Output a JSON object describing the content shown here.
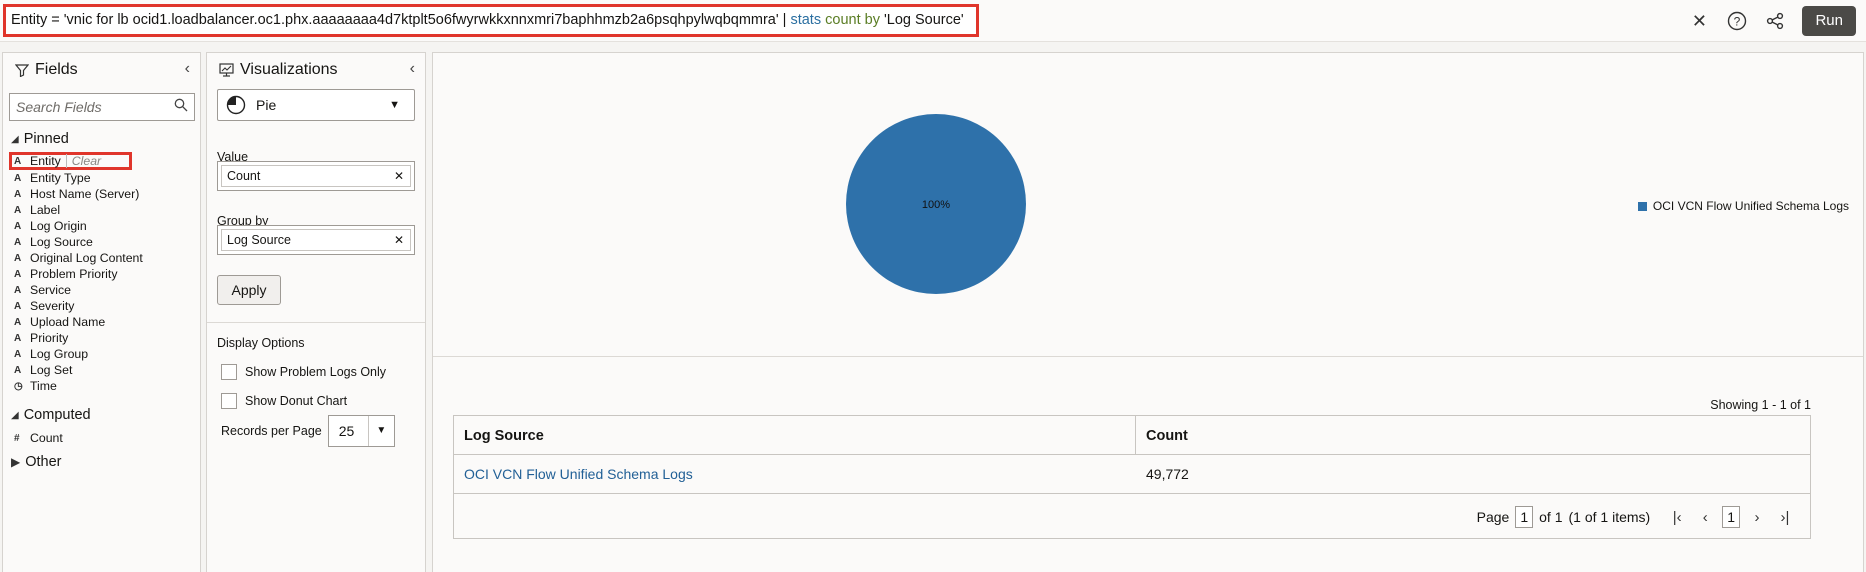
{
  "query": {
    "prefix": "Entity = 'vnic for lb ocid1.loadbalancer.oc1.phx.aaaaaaaa4d7ktplt5o6fwyrwkkxnnxmri7baphhmzb2a6psqhpylwqbqmmra' | ",
    "kw_stats": "stats",
    "kw_count": "count",
    "kw_by": "by",
    "suffix": "'Log Source'"
  },
  "toolbar": {
    "run_label": "Run"
  },
  "fields_panel": {
    "title": "Fields",
    "search_placeholder": "Search Fields",
    "pinned_label": "Pinned",
    "pinned": [
      {
        "type": "A",
        "label": "Entity",
        "clear": "Clear"
      },
      {
        "type": "A",
        "label": "Entity Type"
      },
      {
        "type": "A",
        "label": "Host Name (Server)"
      },
      {
        "type": "A",
        "label": "Label"
      },
      {
        "type": "A",
        "label": "Log Origin"
      },
      {
        "type": "A",
        "label": "Log Source"
      },
      {
        "type": "A",
        "label": "Original Log Content"
      },
      {
        "type": "A",
        "label": "Problem Priority"
      },
      {
        "type": "A",
        "label": "Service"
      },
      {
        "type": "A",
        "label": "Severity"
      },
      {
        "type": "A",
        "label": "Upload Name"
      },
      {
        "type": "A",
        "label": "Priority"
      },
      {
        "type": "A",
        "label": "Log Group"
      },
      {
        "type": "A",
        "label": "Log Set"
      },
      {
        "type": "◷",
        "label": "Time"
      }
    ],
    "computed_label": "Computed",
    "computed": [
      {
        "type": "#",
        "label": "Count"
      }
    ],
    "other_label": "Other"
  },
  "viz_panel": {
    "title": "Visualizations",
    "selected": "Pie",
    "value_label": "Value",
    "value_chip": "Count",
    "groupby_label": "Group by",
    "groupby_chip": "Log Source",
    "apply_label": "Apply",
    "display_options_label": "Display Options",
    "opt_problem": "Show Problem Logs Only",
    "opt_donut": "Show Donut Chart",
    "rpp_label": "Records per Page",
    "rpp_value": "25"
  },
  "chart_data": {
    "type": "pie",
    "slices": [
      {
        "label": "OCI VCN Flow Unified Schema Logs",
        "value": 100,
        "color": "#2e71aa"
      }
    ],
    "data_label": "100%",
    "legend": [
      "OCI VCN Flow Unified Schema Logs"
    ],
    "legend_position": "right"
  },
  "table": {
    "showing": "Showing 1 - 1 of 1",
    "columns": [
      "Log Source",
      "Count"
    ],
    "rows": [
      [
        "OCI VCN Flow Unified Schema Logs",
        "49,772"
      ]
    ],
    "pager": {
      "page_label": "Page",
      "page": "1",
      "of": "of 1",
      "items": "(1 of 1 items)",
      "current": "1"
    }
  }
}
